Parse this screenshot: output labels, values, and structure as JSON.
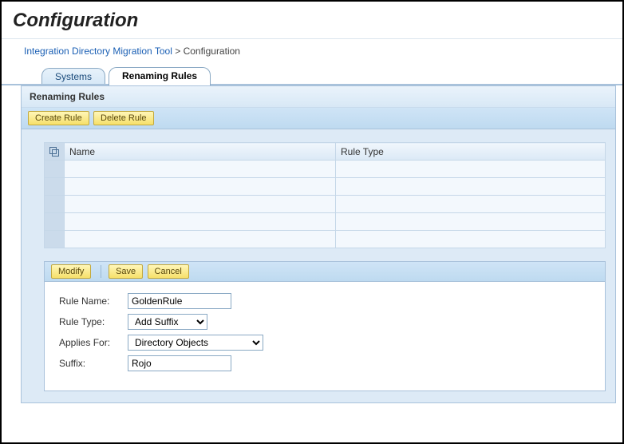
{
  "page": {
    "title": "Configuration"
  },
  "breadcrumb": {
    "link": "Integration Directory Migration Tool",
    "sep": ">",
    "current": "Configuration"
  },
  "tabs": {
    "systems": "Systems",
    "renaming_rules": "Renaming Rules"
  },
  "panel": {
    "title": "Renaming Rules"
  },
  "toolbar": {
    "create": "Create Rule",
    "delete": "Delete Rule"
  },
  "table": {
    "col_name": "Name",
    "col_rule_type": "Rule Type",
    "rows": [
      {
        "name": "",
        "rule_type": ""
      },
      {
        "name": "",
        "rule_type": ""
      },
      {
        "name": "",
        "rule_type": ""
      },
      {
        "name": "",
        "rule_type": ""
      },
      {
        "name": "",
        "rule_type": ""
      }
    ]
  },
  "edit_toolbar": {
    "modify": "Modify",
    "save": "Save",
    "cancel": "Cancel"
  },
  "form": {
    "rule_name_label": "Rule Name:",
    "rule_name_value": "GoldenRule",
    "rule_type_label": "Rule Type:",
    "rule_type_value": "Add Suffix",
    "applies_for_label": "Applies For:",
    "applies_for_value": "Directory Objects",
    "suffix_label": "Suffix:",
    "suffix_value": "Rojo"
  }
}
